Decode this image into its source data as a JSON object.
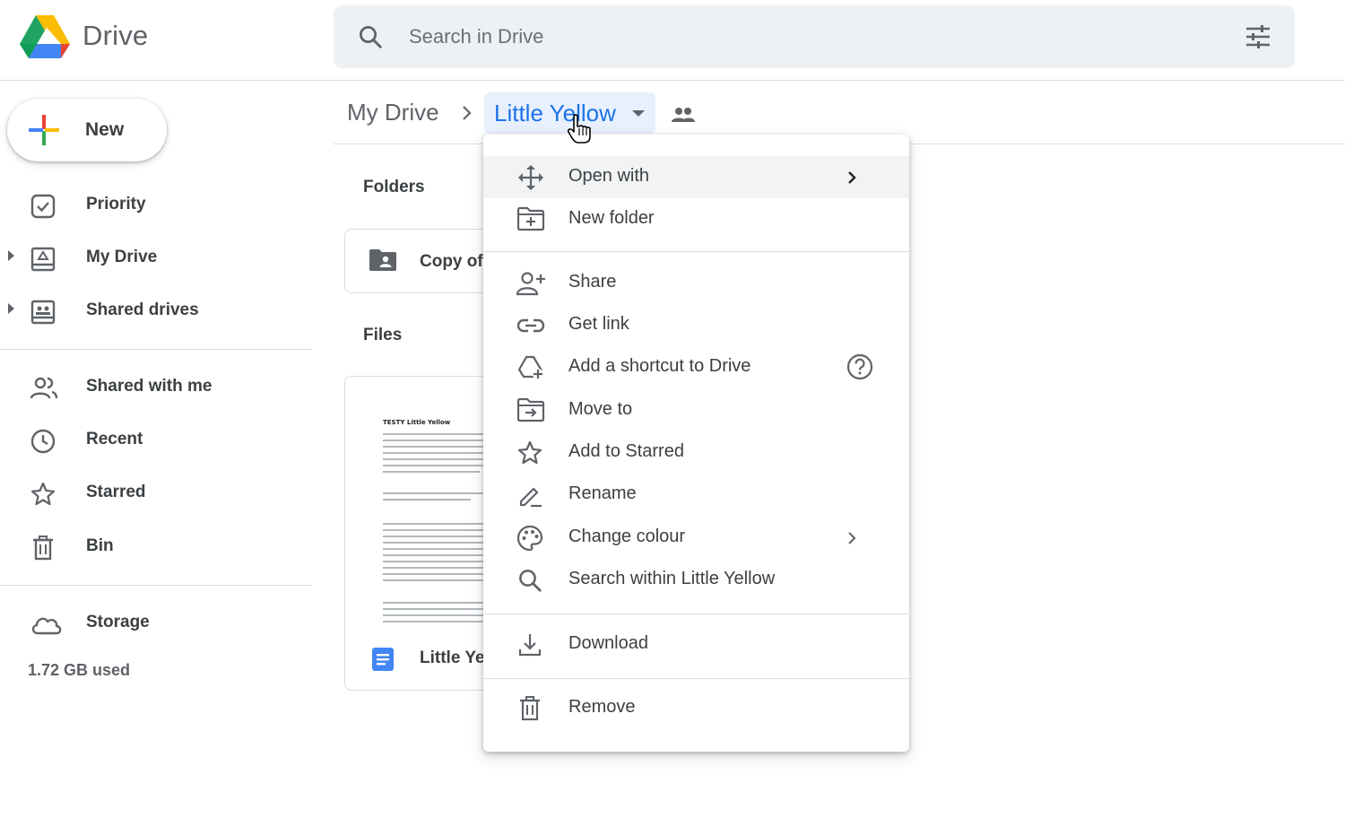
{
  "app": {
    "title": "Drive"
  },
  "search": {
    "placeholder": "Search in Drive",
    "value": ""
  },
  "sidebar": {
    "new_label": "New",
    "items": [
      {
        "label": "Priority",
        "icon": "priority-icon"
      },
      {
        "label": "My Drive",
        "icon": "my-drive-icon"
      },
      {
        "label": "Shared drives",
        "icon": "shared-drives-icon"
      },
      {
        "label": "Shared with me",
        "icon": "shared-with-me-icon"
      },
      {
        "label": "Recent",
        "icon": "clock-icon"
      },
      {
        "label": "Starred",
        "icon": "star-icon"
      },
      {
        "label": "Bin",
        "icon": "trash-icon"
      },
      {
        "label": "Storage",
        "icon": "cloud-icon"
      }
    ],
    "storage_used": "1.72 GB used"
  },
  "breadcrumb": {
    "root": "My Drive",
    "current": "Little Yellow"
  },
  "main": {
    "folders_label": "Folders",
    "files_label": "Files",
    "folder_name": "Copy of",
    "file_name": "Little Ye",
    "thumbnail_title": "TESTY Little Yellow"
  },
  "menu": {
    "items": [
      {
        "label": "Open with",
        "icon": "open-with-icon"
      },
      {
        "label": "New folder",
        "icon": "new-folder-icon"
      },
      {
        "label": "Share",
        "icon": "share-icon"
      },
      {
        "label": "Get link",
        "icon": "link-icon"
      },
      {
        "label": "Add a shortcut to Drive",
        "icon": "add-shortcut-icon"
      },
      {
        "label": "Move to",
        "icon": "move-to-icon"
      },
      {
        "label": "Add to Starred",
        "icon": "star-icon"
      },
      {
        "label": "Rename",
        "icon": "rename-icon"
      },
      {
        "label": "Change colour",
        "icon": "palette-icon"
      },
      {
        "label": "Search within Little Yellow",
        "icon": "search-icon"
      },
      {
        "label": "Download",
        "icon": "download-icon"
      },
      {
        "label": "Remove",
        "icon": "trash-icon"
      }
    ]
  },
  "colors": {
    "accent": "#1a73e8",
    "selected_bg": "#e8f0fe",
    "text": "#3c4043",
    "icon": "#5f6368",
    "divider": "#dadce0"
  }
}
